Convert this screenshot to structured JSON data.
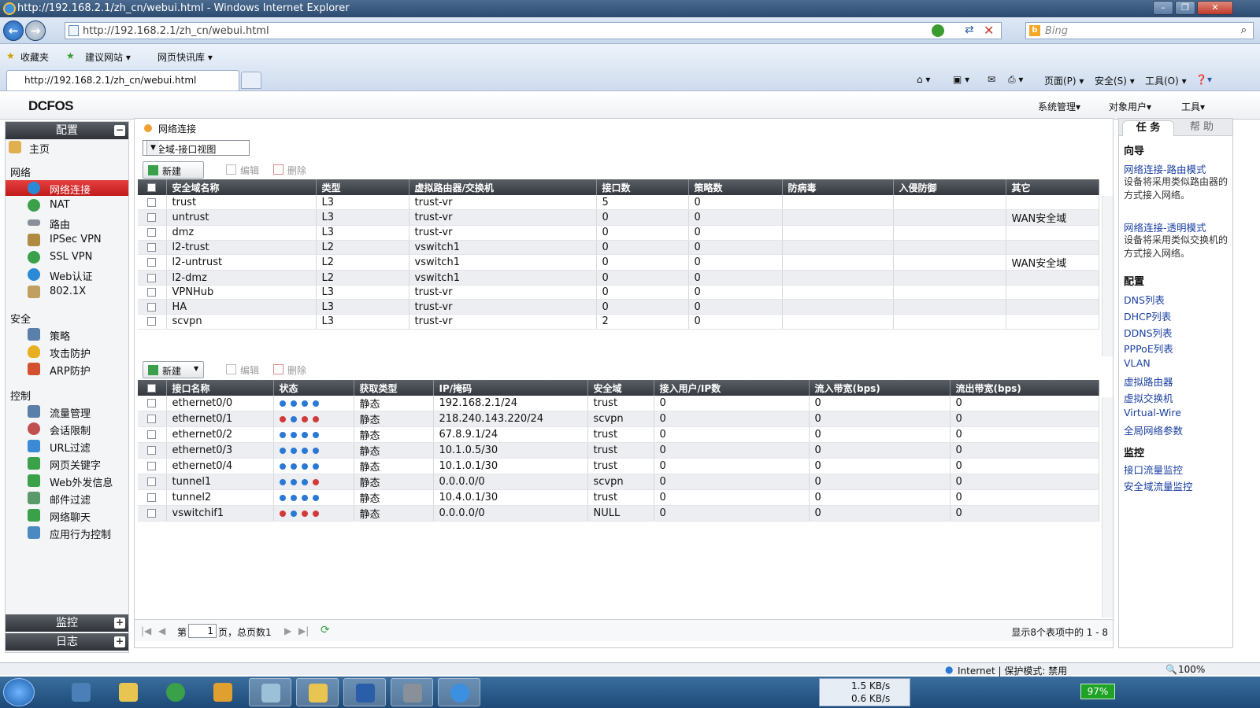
{
  "browser": {
    "title": "http://192.168.2.1/zh_cn/webui.html - Windows Internet Explorer",
    "url": "http://192.168.2.1/zh_cn/webui.html",
    "search_placeholder": "Bing",
    "favorites_label": "收藏夹",
    "fav_links": [
      "建议网站 ▾",
      "网页快讯库 ▾"
    ],
    "tab_title": "http://192.168.2.1/zh_cn/webui.html",
    "commands": [
      "页面(P) ▾",
      "安全(S) ▾",
      "工具(O) ▾"
    ],
    "status_zone": "Internet | 保护模式: 禁用",
    "zoom": "100%"
  },
  "app": {
    "logo": "DCFOS",
    "menus": [
      "系统管理▾",
      "对象用户▾",
      "工具▾"
    ]
  },
  "sidebar": {
    "config_header": "配置",
    "home": "主页",
    "sections": {
      "network": "网络",
      "security": "安全",
      "control": "控制"
    },
    "network_items": [
      "网络连接",
      "NAT",
      "路由",
      "IPSec VPN",
      "SSL VPN",
      "Web认证",
      "802.1X"
    ],
    "security_items": [
      "策略",
      "攻击防护",
      "ARP防护"
    ],
    "control_items": [
      "流量管理",
      "会话限制",
      "URL过滤",
      "网页关键字",
      "Web外发信息",
      "邮件过滤",
      "网络聊天",
      "应用行为控制"
    ],
    "monitor_header": "监控",
    "log_header": "日志"
  },
  "main": {
    "breadcrumb": "网络连接",
    "view_select": "安全域-接口视图",
    "toolbar": {
      "new": "新建",
      "edit": "编辑",
      "delete": "删除"
    },
    "zones": {
      "headers": [
        "安全域名称",
        "类型",
        "虚拟路由器/交换机",
        "接口数",
        "策略数",
        "防病毒",
        "入侵防御",
        "其它"
      ],
      "rows": [
        [
          "trust",
          "L3",
          "trust-vr",
          "5",
          "0",
          "",
          "",
          ""
        ],
        [
          "untrust",
          "L3",
          "trust-vr",
          "0",
          "0",
          "",
          "",
          "WAN安全域"
        ],
        [
          "dmz",
          "L3",
          "trust-vr",
          "0",
          "0",
          "",
          "",
          ""
        ],
        [
          "l2-trust",
          "L2",
          "vswitch1",
          "0",
          "0",
          "",
          "",
          ""
        ],
        [
          "l2-untrust",
          "L2",
          "vswitch1",
          "0",
          "0",
          "",
          "",
          "WAN安全域"
        ],
        [
          "l2-dmz",
          "L2",
          "vswitch1",
          "0",
          "0",
          "",
          "",
          ""
        ],
        [
          "VPNHub",
          "L3",
          "trust-vr",
          "0",
          "0",
          "",
          "",
          ""
        ],
        [
          "HA",
          "L3",
          "trust-vr",
          "0",
          "0",
          "",
          "",
          ""
        ],
        [
          "scvpn",
          "L3",
          "trust-vr",
          "2",
          "0",
          "",
          "",
          ""
        ]
      ]
    },
    "interfaces": {
      "headers": [
        "接口名称",
        "状态",
        "获取类型",
        "IP/掩码",
        "安全域",
        "接入用户/IP数",
        "流入带宽(bps)",
        "流出带宽(bps)"
      ],
      "rows": [
        {
          "name": "ethernet0/0",
          "status": [
            "up",
            "up",
            "up",
            "up"
          ],
          "type": "静态",
          "ip": "192.168.2.1/24",
          "zone": "trust",
          "users": "0",
          "in": "0",
          "out": "0"
        },
        {
          "name": "ethernet0/1",
          "status": [
            "down",
            "up",
            "down",
            "down"
          ],
          "type": "静态",
          "ip": "218.240.143.220/24",
          "zone": "scvpn",
          "users": "0",
          "in": "0",
          "out": "0"
        },
        {
          "name": "ethernet0/2",
          "status": [
            "up",
            "up",
            "up",
            "up"
          ],
          "type": "静态",
          "ip": "67.8.9.1/24",
          "zone": "trust",
          "users": "0",
          "in": "0",
          "out": "0"
        },
        {
          "name": "ethernet0/3",
          "status": [
            "up",
            "up",
            "up",
            "up"
          ],
          "type": "静态",
          "ip": "10.1.0.5/30",
          "zone": "trust",
          "users": "0",
          "in": "0",
          "out": "0"
        },
        {
          "name": "ethernet0/4",
          "status": [
            "up",
            "up",
            "up",
            "up"
          ],
          "type": "静态",
          "ip": "10.1.0.1/30",
          "zone": "trust",
          "users": "0",
          "in": "0",
          "out": "0"
        },
        {
          "name": "tunnel1",
          "status": [
            "up",
            "up",
            "up",
            "down"
          ],
          "type": "静态",
          "ip": "0.0.0.0/0",
          "zone": "scvpn",
          "users": "0",
          "in": "0",
          "out": "0"
        },
        {
          "name": "tunnel2",
          "status": [
            "up",
            "up",
            "up",
            "up"
          ],
          "type": "静态",
          "ip": "10.4.0.1/30",
          "zone": "trust",
          "users": "0",
          "in": "0",
          "out": "0"
        },
        {
          "name": "vswitchif1",
          "status": [
            "down",
            "up",
            "down",
            "down"
          ],
          "type": "静态",
          "ip": "0.0.0.0/0",
          "zone": "NULL",
          "users": "0",
          "in": "0",
          "out": "0"
        }
      ]
    },
    "pager": {
      "page_prefix": "第",
      "page_value": "1",
      "page_suffix": "页，总页数1",
      "summary": "显示8个表项中的 1 - 8"
    }
  },
  "right_panel": {
    "tab_task": "任 务",
    "tab_help": "帮 助",
    "wizard_title": "向导",
    "wizard": [
      {
        "link": "网络连接-路由模式",
        "desc": "设备将采用类似路由器的方式接入网络。"
      },
      {
        "link": "网络连接-透明模式",
        "desc": "设备将采用类似交换机的方式接入网络。"
      }
    ],
    "config_title": "配置",
    "config_links": [
      "DNS列表",
      "DHCP列表",
      "DDNS列表",
      "PPPoE列表",
      "VLAN",
      "虚拟路由器",
      "虚拟交换机",
      "Virtual-Wire",
      "全局网络参数"
    ],
    "monitor_title": "监控",
    "monitor_links": [
      "接口流量监控",
      "安全域流量监控"
    ]
  },
  "taskbar": {
    "net_down": "1.5 KB/s",
    "net_up": "0.6 KB/s",
    "battery": "97%"
  },
  "colors": {
    "active_nav": "#d32020",
    "header_dark": "#3a3e44",
    "link": "#1a3fa0",
    "status_up": "#2a78d6",
    "status_down": "#d23a3a"
  }
}
